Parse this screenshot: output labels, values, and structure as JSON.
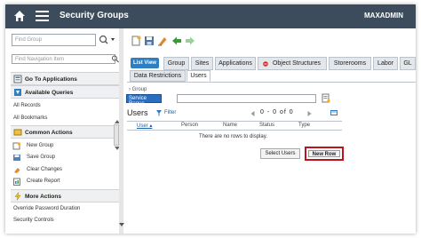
{
  "header": {
    "title": "Security Groups",
    "user": "MAXADMIN"
  },
  "left": {
    "find_group_placeholder": "Find Group",
    "find_nav_placeholder": "Find Navigation Item",
    "go_to_applications": "Go To Applications",
    "available_queries": "Available Queries",
    "queries": [
      "All Records",
      "All Bookmarks"
    ],
    "common_actions": "Common Actions",
    "actions": [
      "New Group",
      "Save Group",
      "Clear Changes",
      "Create Report"
    ],
    "more_actions": "More Actions",
    "more": [
      "Override Password Duration",
      "Security Controls"
    ]
  },
  "tabs": [
    "List View",
    "Group",
    "Sites",
    "Applications",
    "Object Structures",
    "Storerooms",
    "Labor",
    "GL"
  ],
  "subtabs": [
    "Data Restrictions",
    "Users"
  ],
  "form": {
    "group_label": "Group",
    "group_value": "Service Reque"
  },
  "users": {
    "title": "Users",
    "filter": "Filter",
    "paging": "0 - 0 of 0",
    "columns": [
      "User",
      "Person",
      "Name",
      "Status",
      "Type"
    ],
    "empty": "There are no rows to display."
  },
  "buttons": {
    "select_users": "Select Users",
    "new_row": "New Row"
  },
  "colors": {
    "topbar": "#3c4c5c",
    "accent": "#2d7fc1",
    "highlight": "#c0121c"
  }
}
